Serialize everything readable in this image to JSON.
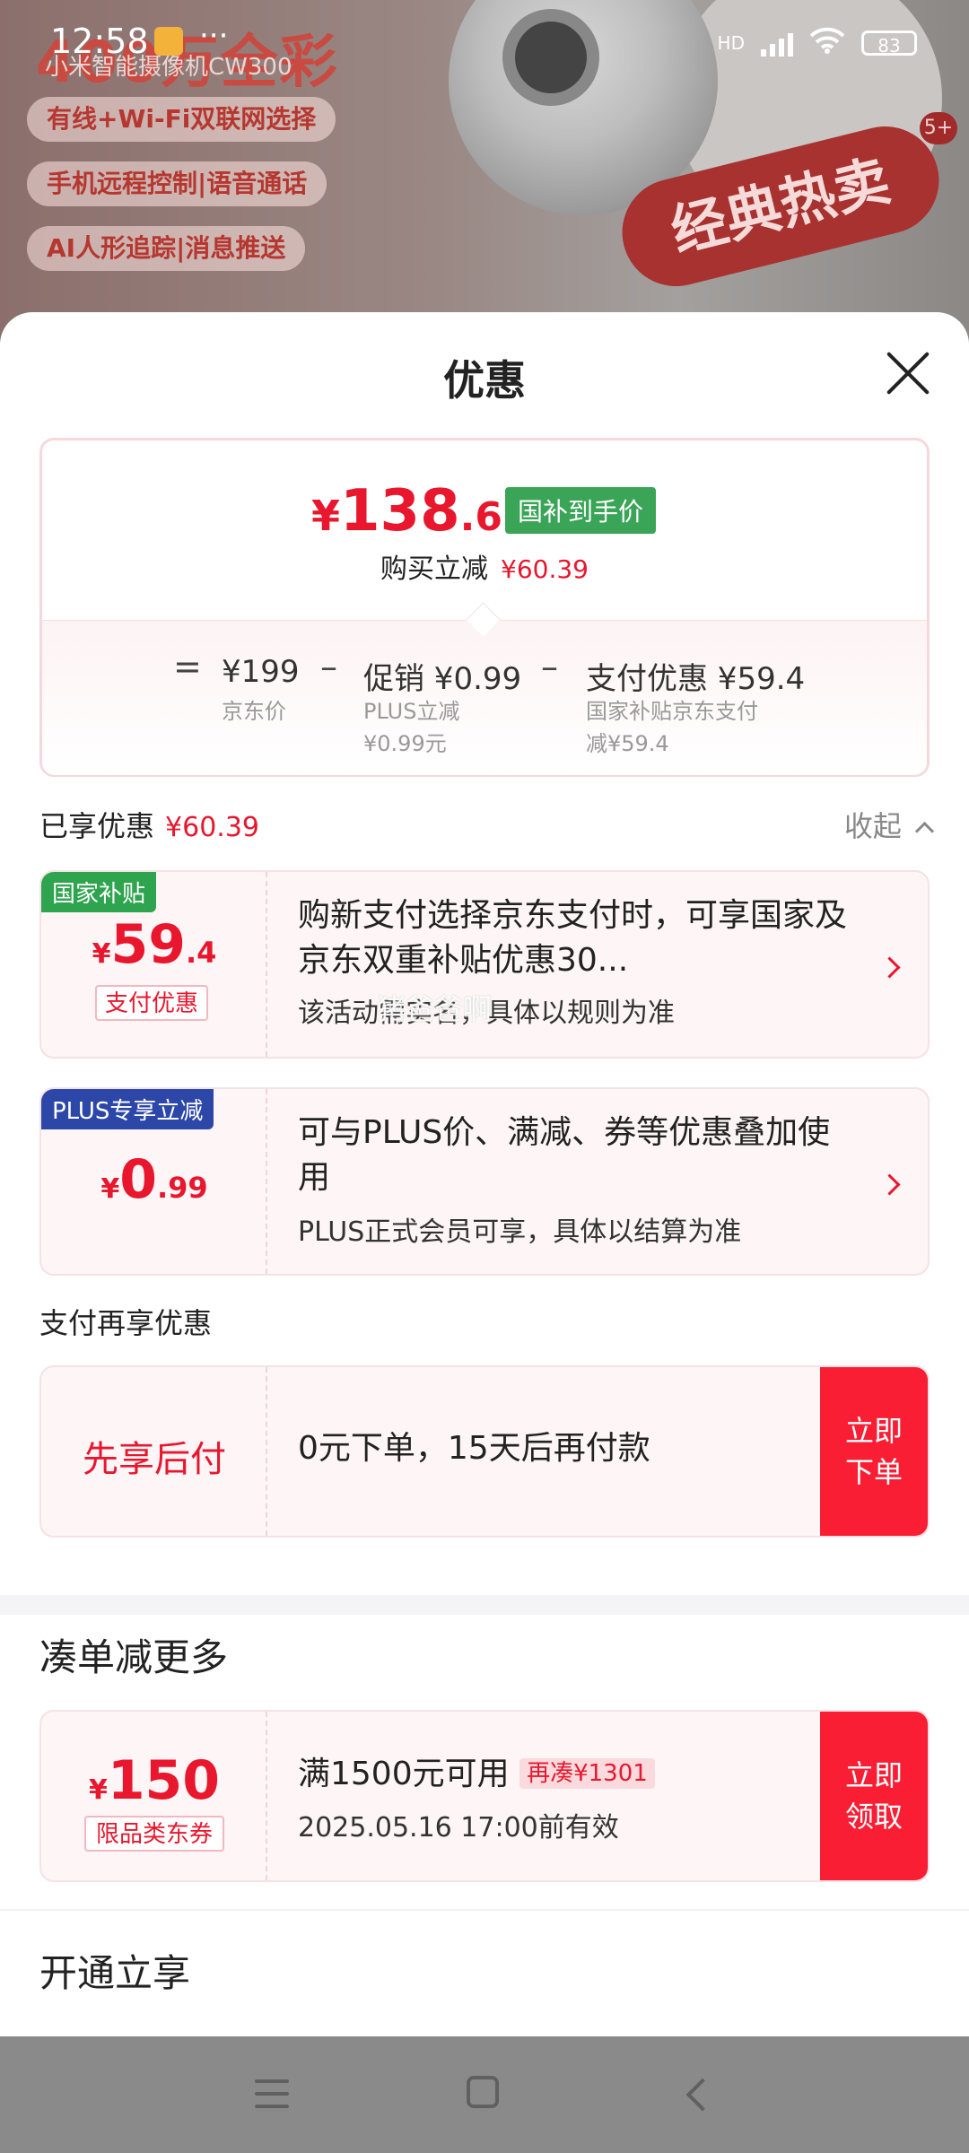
{
  "status_bar": {
    "time": "12:58",
    "dots": "···",
    "network": "HD",
    "battery": "83"
  },
  "background_promo": {
    "headline": "400万全彩",
    "model": "小米智能摄像机CW300",
    "tags": [
      "有线+Wi-Fi双联网选择",
      "手机远程控制|语音通话",
      "AI人形追踪|消息推送"
    ],
    "hot_label": "经典热卖",
    "badge": "5+"
  },
  "sheet": {
    "title": "优惠",
    "price_summary": {
      "currency": "¥",
      "price_int": "138",
      "price_dec": ".61",
      "price_tag": "国补到手价",
      "buy_cut_label": "购买立减",
      "buy_cut_value": "¥60.39",
      "eq": "=",
      "minus": "–",
      "jd_price": "¥199",
      "jd_price_label": "京东价",
      "promo": "促销 ¥0.99",
      "promo_sub1": "PLUS立减",
      "promo_sub2": "¥0.99元",
      "pay": "支付优惠 ¥59.4",
      "pay_sub1": "国家补贴京东支付",
      "pay_sub2": "减¥59.4"
    },
    "enjoyed": {
      "label": "已享优惠",
      "value": "¥60.39",
      "collapse": "收起"
    },
    "offers": [
      {
        "ribbon": "国家补贴",
        "yen": "¥",
        "int": "59",
        "dec": ".4",
        "tag": "支付优惠",
        "desc": "购新支付选择京东支付时，可享国家及京东双重补贴优惠30...",
        "note": "该活动需实名，具体以规则为准"
      },
      {
        "ribbon": "PLUS专享立减",
        "yen": "¥",
        "int": "0",
        "dec": ".99",
        "desc": "可与PLUS价、满减、券等优惠叠加使用",
        "note": "PLUS正式会员可享，具体以结算为准"
      }
    ],
    "pay_more": {
      "label": "支付再享优惠",
      "title": "先享后付",
      "desc": "0元下单，15天后再付款",
      "button": "立即下单"
    },
    "combo": {
      "section_title": "凑单减更多",
      "yen": "¥",
      "amount": "150",
      "tag": "限品类东券",
      "cond": "满1500元可用",
      "more": "再凑¥1301",
      "valid": "2025.05.16 17:00前有效",
      "button": "立即领取"
    },
    "open": {
      "section_title": "开通立享"
    }
  },
  "watermark": "猪爸爸啊"
}
